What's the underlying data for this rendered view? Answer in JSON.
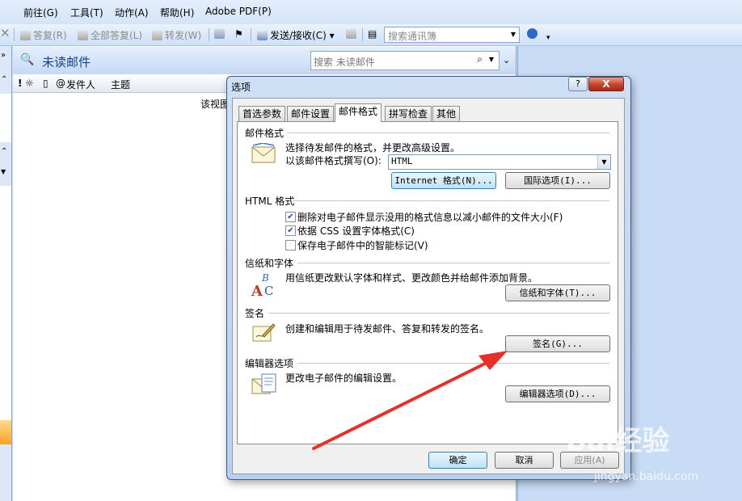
{
  "menubar": {
    "items": [
      "前往(G)",
      "工具(T)",
      "动作(A)",
      "帮助(H)",
      "Adobe PDF(P)"
    ]
  },
  "toolbar": {
    "reply": "答复(R)",
    "reply_all": "全部答复(L)",
    "forward": "转发(W)",
    "send_receive": "发送/接收(C)",
    "address_search_placeholder": "搜索通讯簿"
  },
  "mail_list": {
    "title": "未读邮件",
    "search_placeholder": "搜索 未读邮件",
    "col_from": "发件人",
    "col_subject": "主题",
    "view_text": "该视图"
  },
  "dialog": {
    "title": "选项",
    "help": "?",
    "close": "X",
    "tabs": [
      "首选参数",
      "邮件设置",
      "邮件格式",
      "拼写检查",
      "其他"
    ],
    "active_tab": "邮件格式",
    "mail_format": {
      "heading": "邮件格式",
      "desc": "选择待发邮件的格式，并更改高级设置。",
      "compose_label": "以该邮件格式撰写(O):",
      "compose_value": "HTML",
      "internet_btn": "Internet 格式(N)...",
      "intl_btn": "国际选项(I)..."
    },
    "html_format": {
      "heading": "HTML 格式",
      "options": [
        {
          "label": "删除对电子邮件显示没用的格式信息以减小邮件的文件大小(F)",
          "checked": true
        },
        {
          "label": "依据 CSS 设置字体格式(C)",
          "checked": true
        },
        {
          "label": "保存电子邮件中的智能标记(V)",
          "checked": false
        }
      ]
    },
    "stationery": {
      "heading": "信纸和字体",
      "desc": "用信纸更改默认字体和样式、更改颜色并给邮件添加背景。",
      "btn": "信纸和字体(T)..."
    },
    "signature": {
      "heading": "签名",
      "desc": "创建和编辑用于待发邮件、答复和转发的签名。",
      "btn": "签名(G)..."
    },
    "editor": {
      "heading": "编辑器选项",
      "desc": "更改电子邮件的编辑设置。",
      "btn": "编辑器选项(D)..."
    },
    "ok": "确定",
    "cancel": "取消",
    "apply": "应用(A)"
  },
  "watermark": {
    "brand": "Bai经验",
    "url": "jingyan.baidu.com"
  },
  "colors": {
    "arrow": "#e8302b",
    "close_button": "#c5432a",
    "title_blue": "#15428b"
  }
}
